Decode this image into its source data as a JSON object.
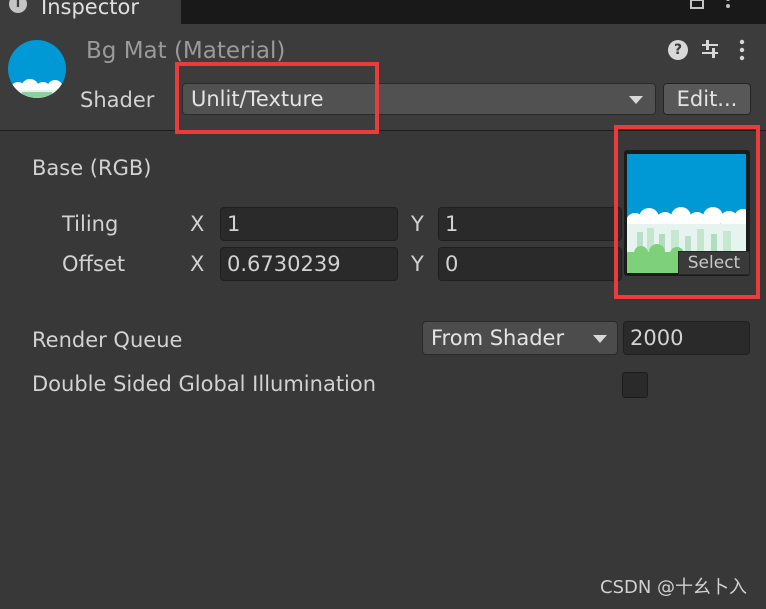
{
  "tab": {
    "label": "Inspector",
    "info_glyph": "i"
  },
  "tab_toolbar": {
    "lock_icon": "lock-icon",
    "menu_icon": "kebab-menu-icon"
  },
  "header": {
    "title": "Bg Mat (Material)",
    "help_glyph": "?",
    "shader_label": "Shader",
    "shader_value": "Unlit/Texture",
    "edit_button": "Edit..."
  },
  "base": {
    "label": "Base (RGB)",
    "tiling_label": "Tiling",
    "offset_label": "Offset",
    "x_label": "X",
    "y_label": "Y",
    "tiling_x": "1",
    "tiling_y": "1",
    "offset_x": "0.6730239",
    "offset_y": "0",
    "texture_select": "Select"
  },
  "render_queue": {
    "label": "Render Queue",
    "mode": "From Shader",
    "value": "2000"
  },
  "double_sided_gi": {
    "label": "Double Sided Global Illumination",
    "checked": false
  },
  "watermark": "CSDN @十幺卜入",
  "colors": {
    "highlight": "#ec3b3b",
    "sky": "#0099d6",
    "panel": "#383838"
  }
}
